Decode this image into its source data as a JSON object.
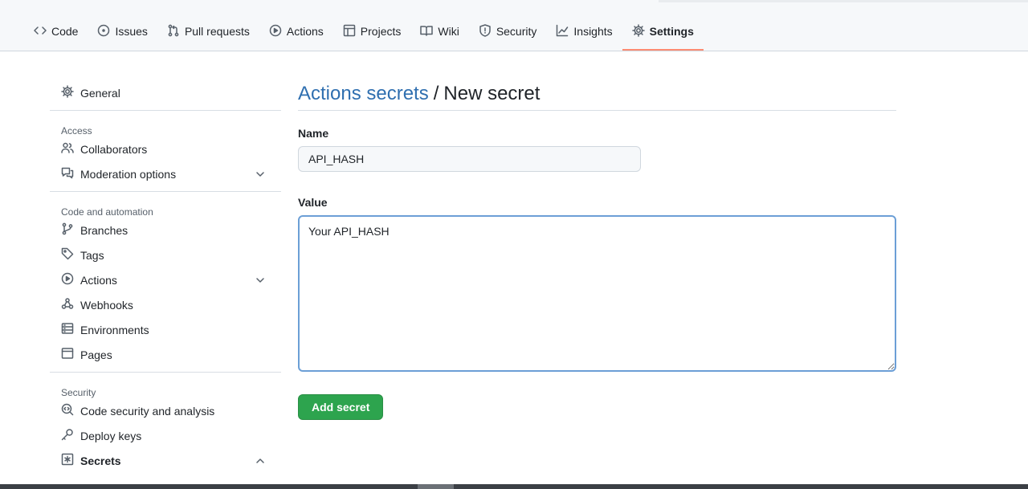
{
  "topnav": {
    "tabs": [
      {
        "label": "Code",
        "icon": "code-icon"
      },
      {
        "label": "Issues",
        "icon": "issue-icon"
      },
      {
        "label": "Pull requests",
        "icon": "pull-request-icon"
      },
      {
        "label": "Actions",
        "icon": "play-icon"
      },
      {
        "label": "Projects",
        "icon": "table-icon"
      },
      {
        "label": "Wiki",
        "icon": "book-icon"
      },
      {
        "label": "Security",
        "icon": "shield-icon"
      },
      {
        "label": "Insights",
        "icon": "graph-icon"
      },
      {
        "label": "Settings",
        "icon": "gear-icon",
        "active": true
      }
    ],
    "active_color": "#fd8c73"
  },
  "sidebar": {
    "general": "General",
    "sections": [
      {
        "heading": "Access",
        "items": [
          {
            "label": "Collaborators",
            "icon": "people-icon"
          },
          {
            "label": "Moderation options",
            "icon": "comment-icon",
            "expandable": true
          }
        ]
      },
      {
        "heading": "Code and automation",
        "items": [
          {
            "label": "Branches",
            "icon": "branch-icon"
          },
          {
            "label": "Tags",
            "icon": "tag-icon"
          },
          {
            "label": "Actions",
            "icon": "play-icon",
            "expandable": true
          },
          {
            "label": "Webhooks",
            "icon": "webhook-icon"
          },
          {
            "label": "Environments",
            "icon": "server-icon"
          },
          {
            "label": "Pages",
            "icon": "browser-icon"
          }
        ]
      },
      {
        "heading": "Security",
        "items": [
          {
            "label": "Code security and analysis",
            "icon": "codescan-icon"
          },
          {
            "label": "Deploy keys",
            "icon": "key-icon"
          },
          {
            "label": "Secrets",
            "icon": "asterisk-icon",
            "expanded": true,
            "selected": true
          }
        ]
      }
    ]
  },
  "main": {
    "breadcrumb_link": "Actions secrets",
    "separator": "/",
    "page_title": "New secret",
    "name_label": "Name",
    "name_value": "API_HASH",
    "value_label": "Value",
    "value_text": "Your API_HASH",
    "submit_label": "Add secret"
  },
  "colors": {
    "primary_button": "#2da44e",
    "link": "#2f6fb0",
    "focus_border": "#6c9fd6"
  }
}
